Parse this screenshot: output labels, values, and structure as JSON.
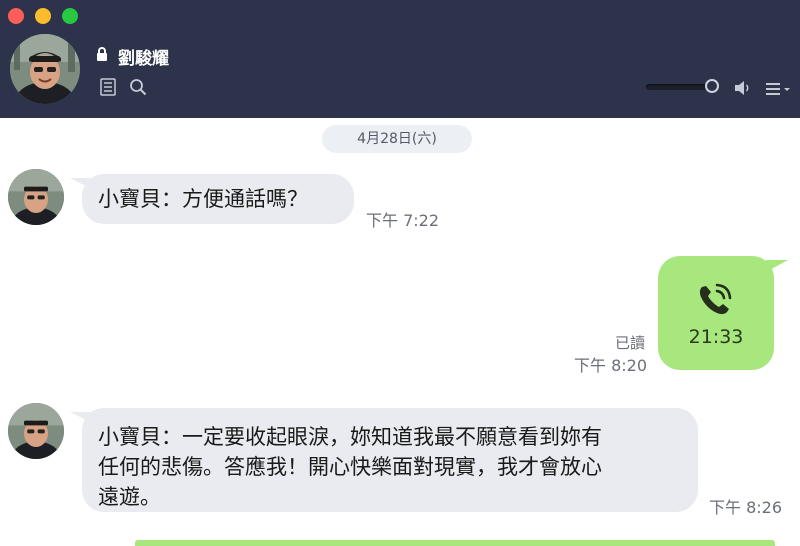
{
  "window": {
    "controls": [
      "close",
      "minimize",
      "zoom"
    ]
  },
  "header": {
    "contact_name": "劉駿耀",
    "icons": [
      "lock-icon",
      "notes-icon",
      "search-icon",
      "speaker-icon",
      "menu-icon"
    ],
    "volume_level": 0.9
  },
  "chat": {
    "date_divider": "4月28日(六)",
    "messages": [
      {
        "direction": "incoming",
        "text": "小寶貝：方便通話嗎？",
        "time": "下午 7:22"
      },
      {
        "direction": "outgoing",
        "type": "call",
        "icon": "phone-call-icon",
        "duration": "21:33",
        "read": "已讀",
        "time": "下午 8:20"
      },
      {
        "direction": "incoming",
        "lines": [
          "小寶貝：一定要收起眼淚，妳知道我最不願意看到妳有",
          "任何的悲傷。答應我！開心快樂面對現實，我才會放心",
          "遠遊。"
        ],
        "time": "下午 8:26"
      }
    ]
  },
  "colors": {
    "header_bg": "#2c334a",
    "incoming_bubble": "#e9ebf0",
    "outgoing_bubble": "#a8e67e",
    "date_pill": "#eceff3"
  }
}
